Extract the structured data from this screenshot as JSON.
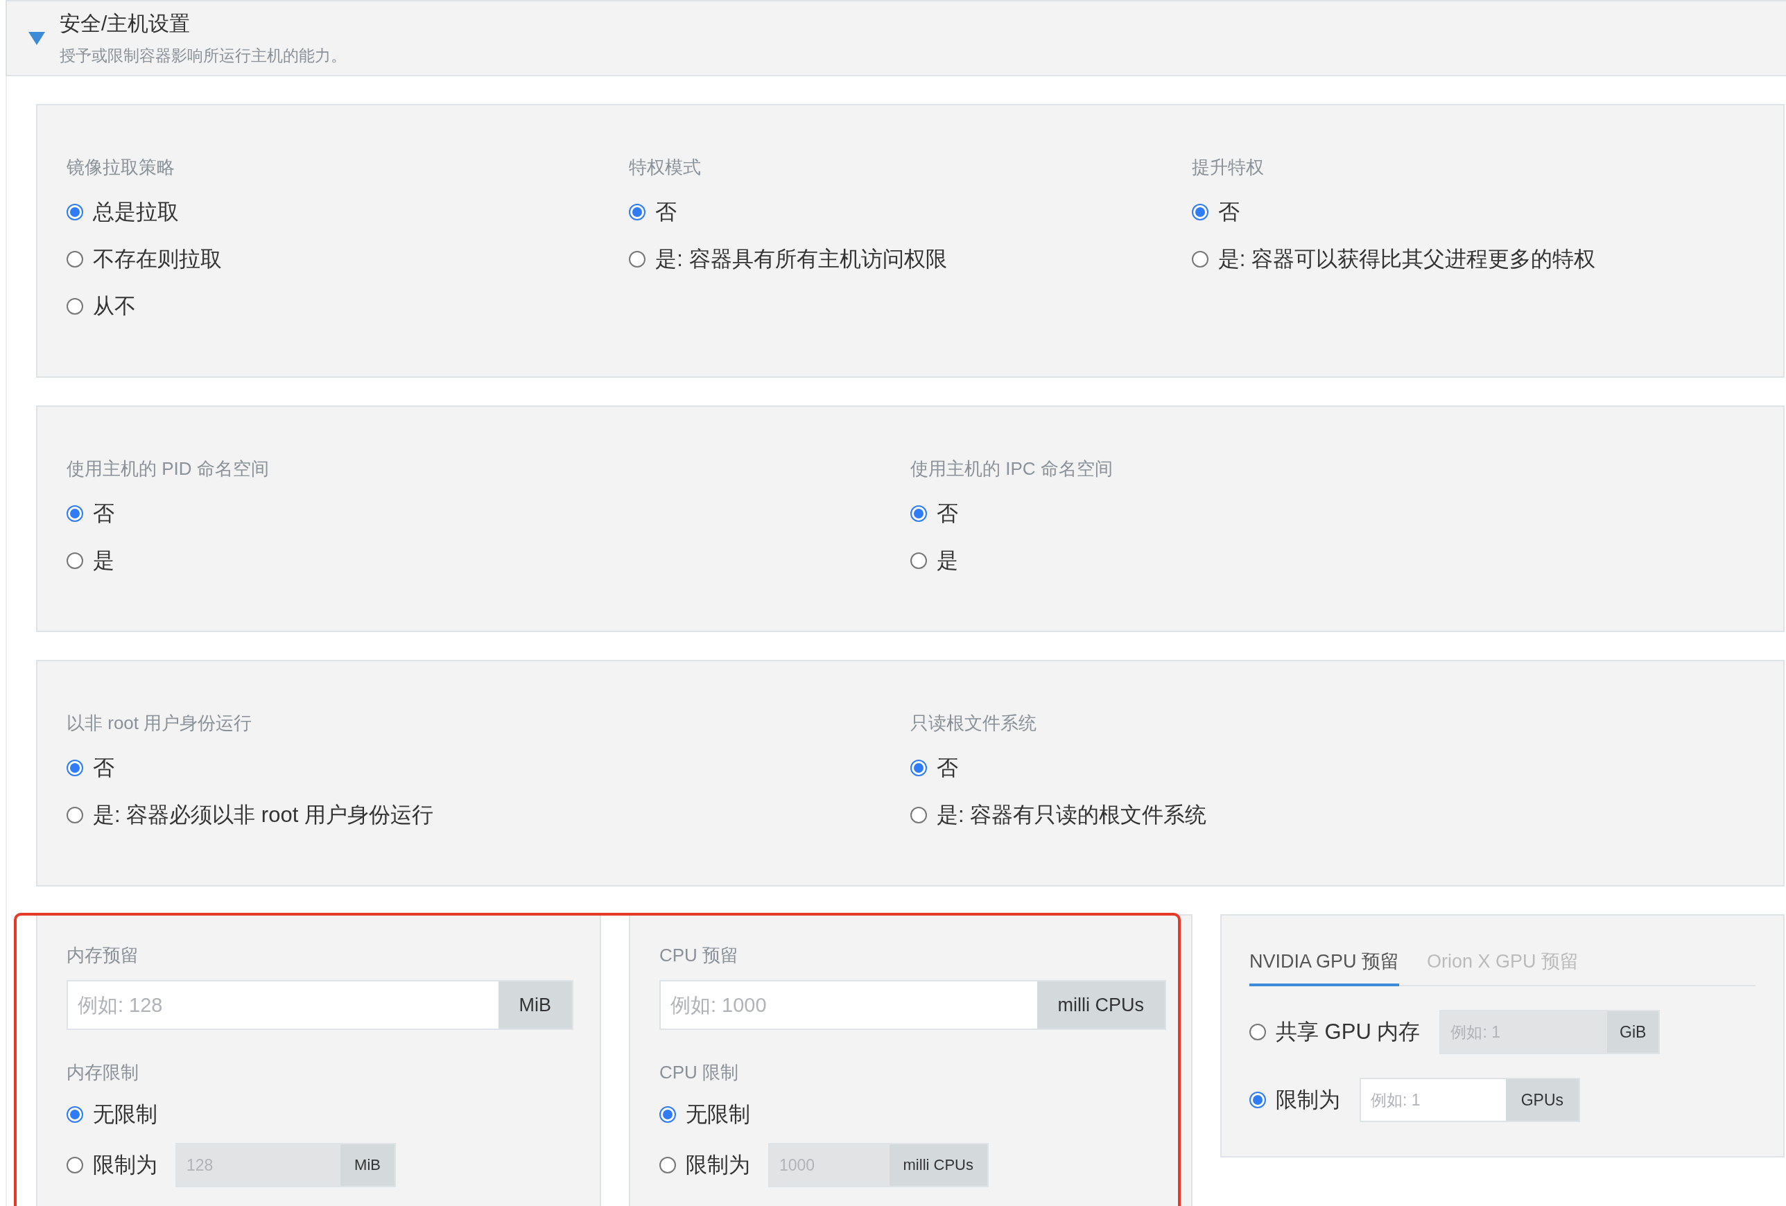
{
  "section": {
    "title": "安全/主机设置",
    "description": "授予或限制容器影响所运行主机的能力。",
    "expanded": true
  },
  "groups": [
    {
      "fields": [
        {
          "label": "镜像拉取策略",
          "options": [
            {
              "label": "总是拉取",
              "selected": true
            },
            {
              "label": "不存在则拉取",
              "selected": false
            },
            {
              "label": "从不",
              "selected": false
            }
          ]
        },
        {
          "label": "特权模式",
          "options": [
            {
              "label": "否",
              "selected": true
            },
            {
              "label": "是: 容器具有所有主机访问权限",
              "selected": false
            }
          ]
        },
        {
          "label": "提升特权",
          "options": [
            {
              "label": "否",
              "selected": true
            },
            {
              "label": "是: 容器可以获得比其父进程更多的特权",
              "selected": false
            }
          ]
        }
      ]
    },
    {
      "fields": [
        {
          "label": "使用主机的 PID 命名空间",
          "options": [
            {
              "label": "否",
              "selected": true
            },
            {
              "label": "是",
              "selected": false
            }
          ]
        },
        {
          "label": "使用主机的 IPC 命名空间",
          "options": [
            {
              "label": "否",
              "selected": true
            },
            {
              "label": "是",
              "selected": false
            }
          ]
        }
      ]
    },
    {
      "fields": [
        {
          "label": "以非 root 用户身份运行",
          "options": [
            {
              "label": "否",
              "selected": true
            },
            {
              "label": "是: 容器必须以非 root 用户身份运行",
              "selected": false
            }
          ]
        },
        {
          "label": "只读根文件系统",
          "options": [
            {
              "label": "否",
              "selected": true
            },
            {
              "label": "是: 容器有只读的根文件系统",
              "selected": false
            }
          ]
        }
      ]
    }
  ],
  "resources": [
    {
      "reservation": {
        "label": "内存预留",
        "placeholder": "例如: 128",
        "unit": "MiB"
      },
      "limit": {
        "label": "内存限制",
        "options": [
          {
            "label": "无限制",
            "selected": true
          },
          {
            "label": "限制为",
            "selected": false,
            "placeholder": "128",
            "unit": "MiB",
            "disabled": true
          }
        ]
      }
    },
    {
      "reservation": {
        "label": "CPU 预留",
        "placeholder": "例如: 1000",
        "unit": "milli CPUs"
      },
      "limit": {
        "label": "CPU 限制",
        "options": [
          {
            "label": "无限制",
            "selected": true
          },
          {
            "label": "限制为",
            "selected": false,
            "placeholder": "1000",
            "unit": "milli CPUs",
            "disabled": true
          }
        ]
      }
    }
  ],
  "gpu": {
    "tabs": [
      {
        "label": "NVIDIA GPU 预留",
        "selected": true
      },
      {
        "label": "Orion X GPU 预留",
        "selected": false
      }
    ],
    "options": [
      {
        "label": "共享 GPU 内存",
        "selected": false,
        "placeholder": "例如: 1",
        "unit": "GiB",
        "disabled": true
      },
      {
        "label": "限制为",
        "selected": true,
        "placeholder": "例如: 1",
        "unit": "GPUs",
        "disabled": false
      }
    ]
  }
}
